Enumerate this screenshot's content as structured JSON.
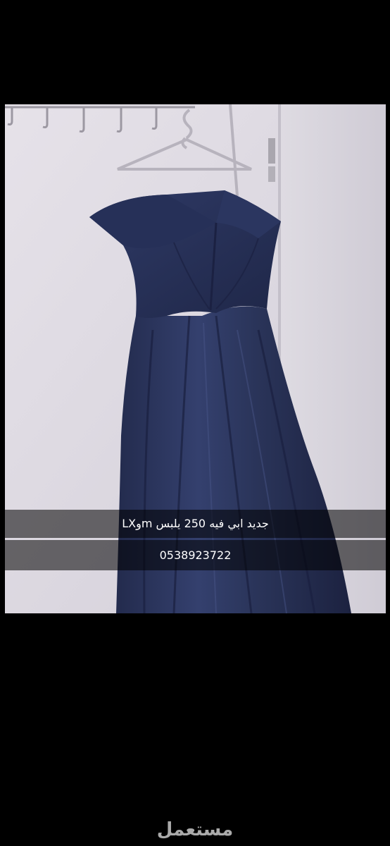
{
  "photo": {
    "caption_line_1": "جديد ابي فيه 250 يلبس mوLX",
    "caption_line_2": "0538923722",
    "dress_color": "#2c3660",
    "wall_color": "#dcd8e0"
  },
  "watermark": {
    "text": "مستعمل"
  }
}
